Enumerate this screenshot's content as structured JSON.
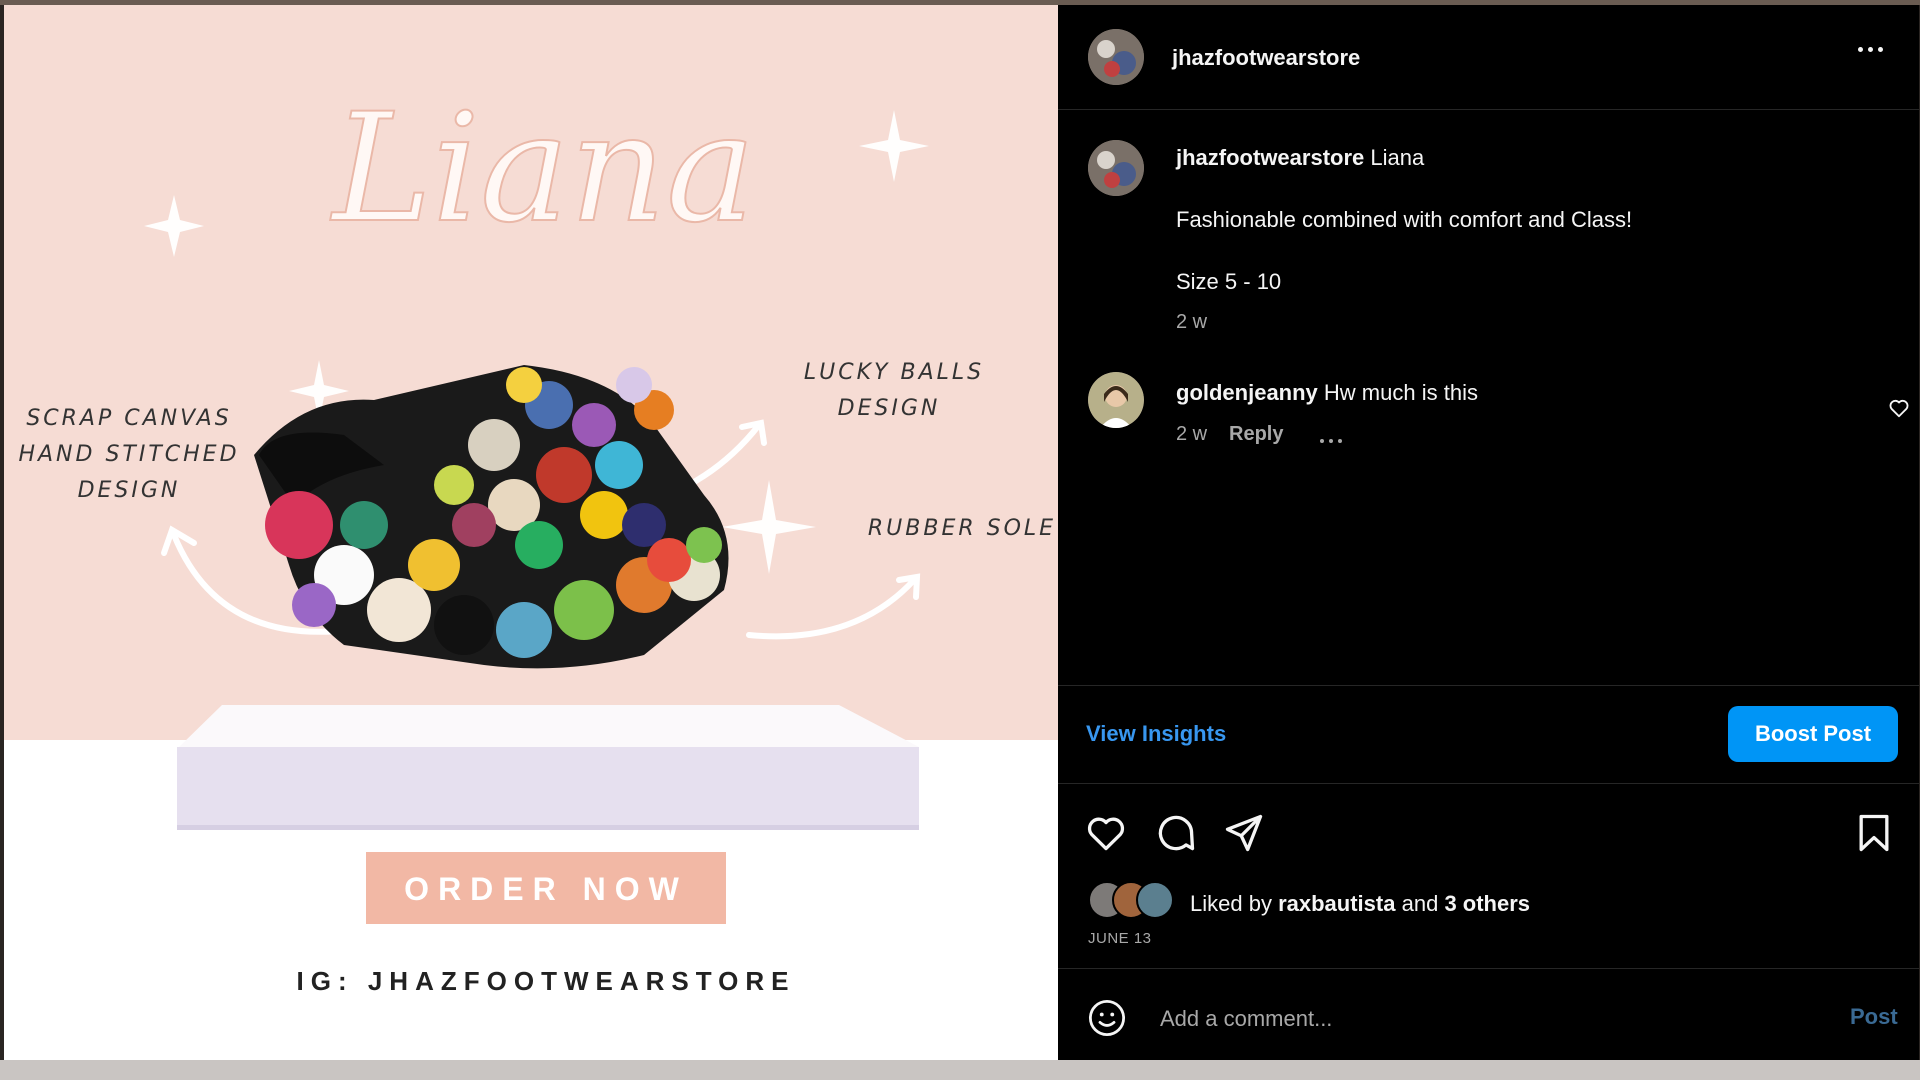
{
  "post": {
    "username": "jhazfootwearstore",
    "caption_title": "Liana",
    "caption_line1": "Fashionable combined with comfort and Class!",
    "caption_line2": "Size 5 - 10",
    "caption_age": "2 w"
  },
  "comment": {
    "username": "goldenjeanny",
    "text": "Hw much is this",
    "age": "2 w",
    "reply_label": "Reply"
  },
  "actions": {
    "insights_label": "View Insights",
    "boost_label": "Boost Post"
  },
  "likes": {
    "prefix": "Liked by",
    "user": "raxbautista",
    "joiner": "and",
    "others": "3 others",
    "date": "JUNE 13"
  },
  "composer": {
    "placeholder": "Add a comment...",
    "post_label": "Post"
  },
  "image": {
    "title": "Liana",
    "callout_left": [
      "SCRAP CANVAS",
      "HAND STITCHED",
      "DESIGN"
    ],
    "callout_top_right": [
      "LUCKY BALLS",
      "DESIGN"
    ],
    "callout_right": "RUBBER SOLE",
    "order_label": "ORDER NOW",
    "ig_handle": "IG: JHAZFOOTWEARSTORE"
  },
  "colors": {
    "accent_blue": "#0095f6",
    "link_blue": "#3897f0",
    "image_bg": "#f6dcd4",
    "order_btn": "#f2b8a5"
  },
  "icons": [
    "more-options-icon",
    "heart-icon",
    "comment-icon",
    "share-icon",
    "bookmark-icon",
    "emoji-icon",
    "small-heart-icon"
  ]
}
